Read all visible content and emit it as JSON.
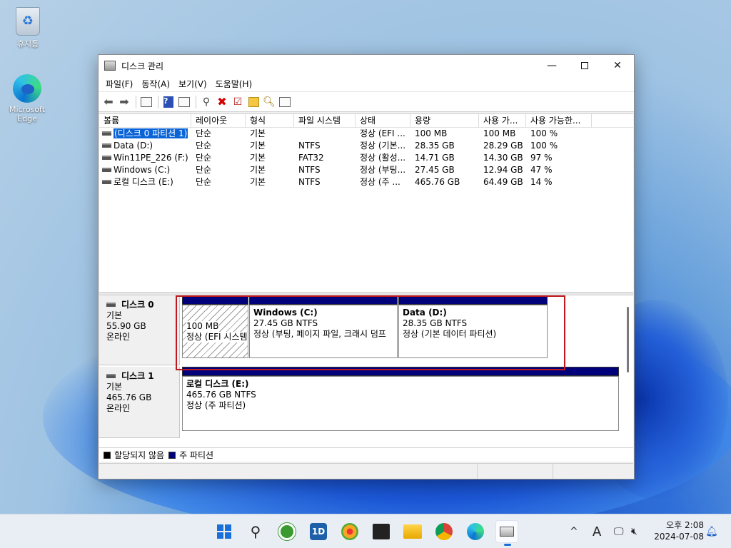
{
  "desktop": {
    "icons": [
      {
        "label": "휴지통",
        "icon": "recycle-bin-icon"
      },
      {
        "label": "Microsoft Edge",
        "icon": "edge-icon"
      }
    ]
  },
  "window": {
    "title": "디스크 관리",
    "controls": {
      "minimize": "—",
      "maximize": "□",
      "close": "✕"
    },
    "menu": [
      "파일(F)",
      "동작(A)",
      "보기(V)",
      "도움말(H)"
    ],
    "toolbar": [
      "back-icon",
      "forward-icon",
      "show-hide-console-icon",
      "help-icon",
      "properties-icon",
      "connect-icon",
      "delete-icon",
      "check-icon",
      "import-icon",
      "search-icon",
      "wizard-icon"
    ]
  },
  "volume_list": {
    "columns": [
      "볼륨",
      "레이아웃",
      "형식",
      "파일 시스템",
      "상태",
      "용량",
      "사용 가...",
      "사용 가능한..."
    ],
    "rows": [
      {
        "volume": "(디스크 0 파티션 1)",
        "layout": "단순",
        "type": "기본",
        "fs": "",
        "status": "정상 (EFI ...",
        "capacity": "100 MB",
        "free": "100 MB",
        "pct": "100 %",
        "selected": true
      },
      {
        "volume": "Data (D:)",
        "layout": "단순",
        "type": "기본",
        "fs": "NTFS",
        "status": "정상 (기본...",
        "capacity": "28.35 GB",
        "free": "28.29 GB",
        "pct": "100 %",
        "selected": false
      },
      {
        "volume": "Win11PE_226 (F:)",
        "layout": "단순",
        "type": "기본",
        "fs": "FAT32",
        "status": "정상 (활성...",
        "capacity": "14.71 GB",
        "free": "14.30 GB",
        "pct": "97 %",
        "selected": false
      },
      {
        "volume": "Windows (C:)",
        "layout": "단순",
        "type": "기본",
        "fs": "NTFS",
        "status": "정상 (부팅...",
        "capacity": "27.45 GB",
        "free": "12.94 GB",
        "pct": "47 %",
        "selected": false
      },
      {
        "volume": "로컬 디스크 (E:)",
        "layout": "단순",
        "type": "기본",
        "fs": "NTFS",
        "status": "정상 (주 ...",
        "capacity": "465.76 GB",
        "free": "64.49 GB",
        "pct": "14 %",
        "selected": false
      }
    ]
  },
  "disks": [
    {
      "name": "디스크 0",
      "kind": "기본",
      "size": "55.90 GB",
      "state": "온라인",
      "partitions": [
        {
          "name": "",
          "size": "100 MB",
          "status": "정상 (EFI 시스템 파티션)",
          "hatched": true
        },
        {
          "name": "Windows  (C:)",
          "size": "27.45 GB NTFS",
          "status": "정상 (부팅, 페이지 파일, 크래시 덤프",
          "hatched": false
        },
        {
          "name": "Data  (D:)",
          "size": "28.35 GB NTFS",
          "status": "정상 (기본 데이터 파티션)",
          "hatched": false
        }
      ]
    },
    {
      "name": "디스크 1",
      "kind": "기본",
      "size": "465.76 GB",
      "state": "온라인",
      "partitions": [
        {
          "name": "로컬 디스크  (E:)",
          "size": "465.76 GB NTFS",
          "status": "정상 (주 파티션)",
          "hatched": false
        }
      ]
    }
  ],
  "legend": {
    "unallocated": "할당되지 않음",
    "primary": "주 파티션",
    "colors": {
      "unallocated": "#000000",
      "primary": "#00007b"
    }
  },
  "taskbar": {
    "apps": [
      "start-icon",
      "search-icon",
      "utorrent-icon",
      "onedrive-app-icon",
      "screenshot-tool-icon",
      "media-player-icon",
      "file-explorer-icon",
      "chrome-icon",
      "edge-icon",
      "disk-management-icon"
    ],
    "tray": {
      "chevron": "^",
      "ime": "A"
    },
    "clock_time": "오후 2:08",
    "clock_date": "2024-07-08"
  },
  "colors": {
    "accent": "#0a64d8",
    "highlight_box": "#c0191d",
    "partition_bar": "#00007b"
  }
}
